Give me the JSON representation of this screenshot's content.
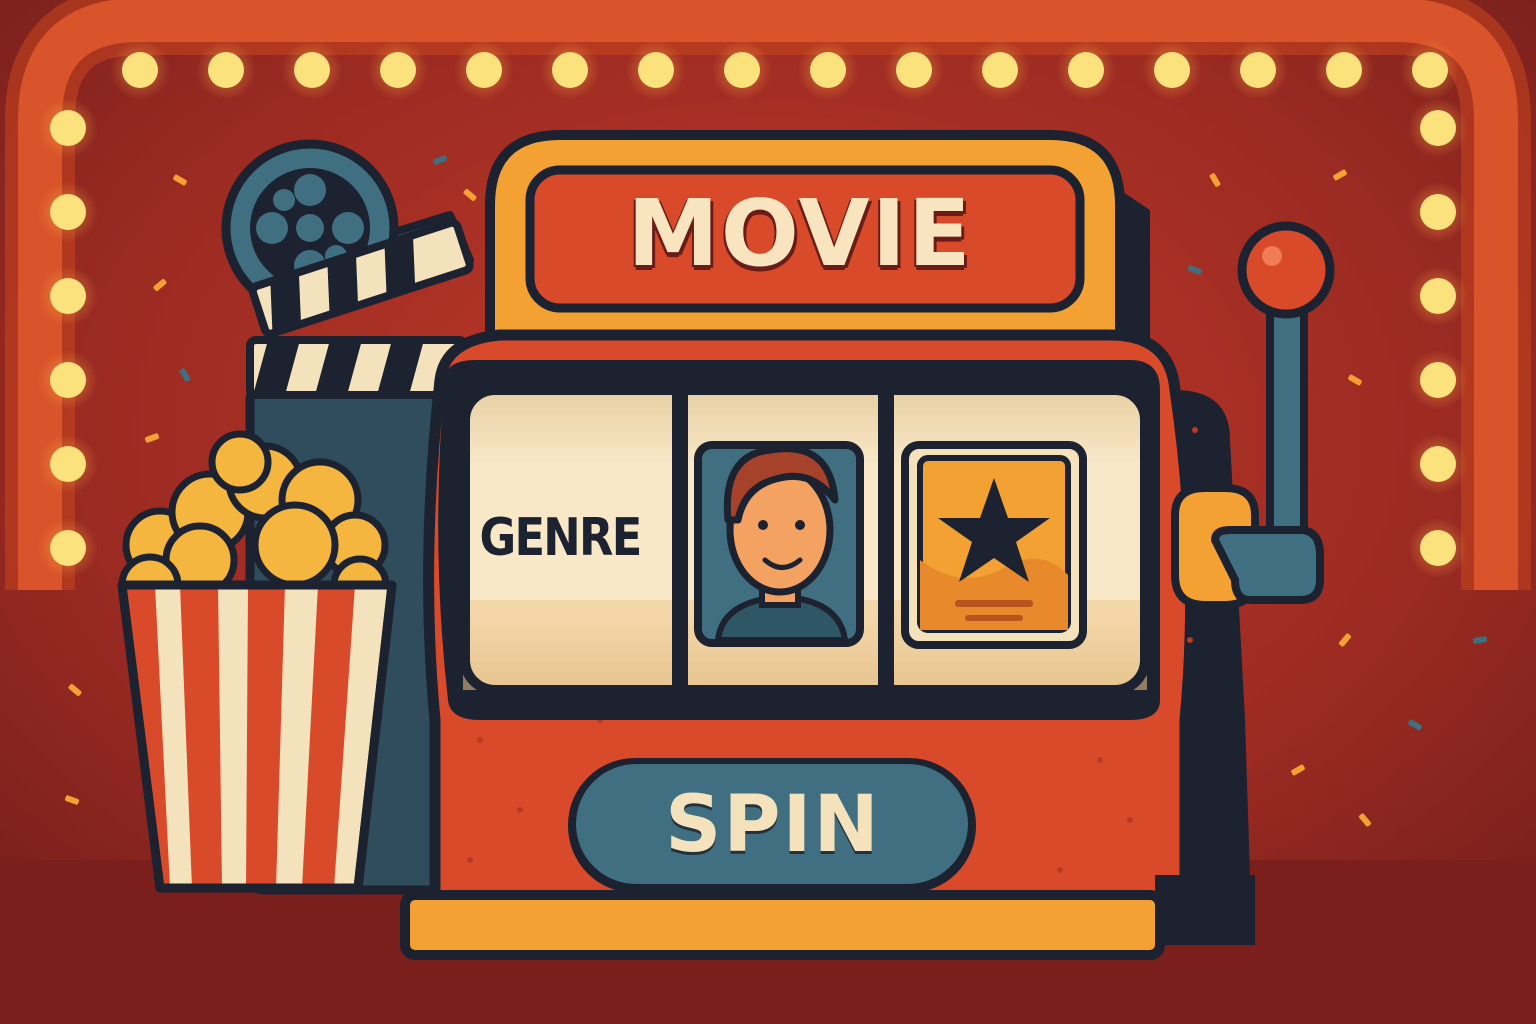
{
  "machine": {
    "title": "MOVIE",
    "reels": [
      {
        "kind": "text",
        "label": "GENRE"
      },
      {
        "kind": "icon",
        "icon": "actor-portrait-icon"
      },
      {
        "kind": "icon",
        "icon": "star-poster-icon"
      }
    ],
    "spin_label": "SPIN",
    "lever_icon": "slot-lever-icon"
  },
  "decorations": [
    "film-reel-icon",
    "clapperboard-icon",
    "popcorn-bucket-icon",
    "marquee-lights",
    "confetti"
  ],
  "colors": {
    "background": "#8c2520",
    "machine_red": "#d94a2b",
    "machine_orange": "#f2a132",
    "reel_cream": "#f6e4c3",
    "teal": "#3f6f80",
    "outline": "#1c2230",
    "bulb": "#fbe27c"
  }
}
